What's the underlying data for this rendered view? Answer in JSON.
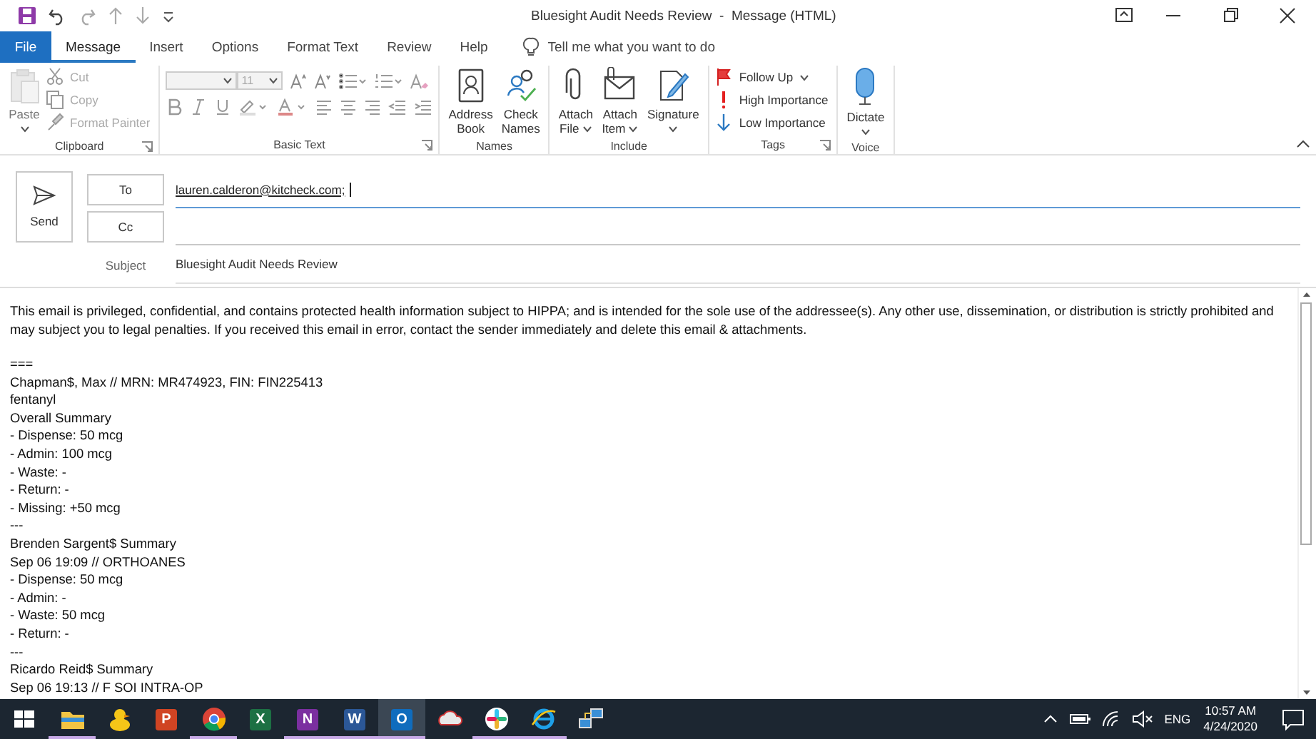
{
  "window": {
    "title": "Bluesight Audit Needs Review  -  Message (HTML)"
  },
  "tabs": [
    {
      "label": "File",
      "kind": "file",
      "selected": false
    },
    {
      "label": "Message",
      "kind": "tab",
      "selected": true
    },
    {
      "label": "Insert",
      "kind": "tab",
      "selected": false
    },
    {
      "label": "Options",
      "kind": "tab",
      "selected": false
    },
    {
      "label": "Format Text",
      "kind": "tab",
      "selected": false
    },
    {
      "label": "Review",
      "kind": "tab",
      "selected": false
    },
    {
      "label": "Help",
      "kind": "tab",
      "selected": false
    }
  ],
  "tell_me": {
    "placeholder": "Tell me what you want to do"
  },
  "ribbon": {
    "groups": [
      {
        "label": "Clipboard",
        "launcher": true,
        "large": [
          {
            "lines": [
              "Paste"
            ],
            "caret": true,
            "disabled": true
          }
        ],
        "small": [
          {
            "label": "Cut",
            "disabled": true
          },
          {
            "label": "Copy",
            "disabled": true
          },
          {
            "label": "Format Painter",
            "disabled": true
          }
        ]
      },
      {
        "label": "Basic Text",
        "launcher": true,
        "kind": "font",
        "font_size": "11",
        "disabled": true
      },
      {
        "label": "Names",
        "large": [
          {
            "lines": [
              "Address",
              "Book"
            ],
            "caret": false,
            "disabled": false
          },
          {
            "lines": [
              "Check",
              "Names"
            ],
            "caret": false,
            "disabled": false
          }
        ]
      },
      {
        "label": "Include",
        "large": [
          {
            "lines": [
              "Attach",
              "File"
            ],
            "caret": true,
            "disabled": false
          },
          {
            "lines": [
              "Attach",
              "Item"
            ],
            "caret": true,
            "disabled": false
          },
          {
            "lines": [
              "Signature"
            ],
            "caret": true,
            "disabled": false
          }
        ]
      },
      {
        "label": "Tags",
        "launcher": true,
        "small": [
          {
            "label": "Follow Up",
            "caret": true,
            "disabled": false
          },
          {
            "label": "High Importance",
            "disabled": false
          },
          {
            "label": "Low Importance",
            "disabled": false
          }
        ]
      },
      {
        "label": "Voice",
        "large": [
          {
            "lines": [
              "Dictate"
            ],
            "caret": true,
            "disabled": false
          }
        ]
      }
    ]
  },
  "compose": {
    "send": "Send",
    "to_button": "To",
    "to_value": "lauren.calderon@kitcheck.com;",
    "cc_button": "Cc",
    "subject_label": "Subject",
    "subject_value": "Bluesight Audit Needs Review"
  },
  "body": {
    "disclaimer": "This email is privileged, confidential, and contains protected health information subject to HIPPA; and is intended for the sole use of the addressee(s). Any other use, dissemination, or distribution is strictly prohibited and may subject you to legal penalties. If you received this email in error, contact the sender immediately and delete this email & attachments.",
    "lines": [
      "===",
      "Chapman$, Max // MRN: MR474923, FIN: FIN225413",
      "fentanyl",
      "Overall Summary",
      "- Dispense: 50 mcg",
      "- Admin: 100 mcg",
      "- Waste: -",
      "- Return: -",
      "- Missing: +50 mcg",
      "---",
      "Brenden Sargent$ Summary",
      "Sep 06 19:09 // ORTHOANES",
      "- Dispense: 50 mcg",
      "- Admin: -",
      "- Waste: 50 mcg",
      "- Return: -",
      "---",
      "Ricardo Reid$ Summary",
      "Sep 06 19:13 // F SOI INTRA-OP"
    ]
  },
  "taskbar": {
    "apps": [
      {
        "kind": "folder",
        "running": true,
        "active": false
      },
      {
        "kind": "duck",
        "running": false,
        "active": false
      },
      {
        "kind": "letter",
        "glyph": "P",
        "color": "#d04423",
        "running": false,
        "active": false
      },
      {
        "kind": "chrome",
        "running": true,
        "active": false
      },
      {
        "kind": "letter",
        "glyph": "X",
        "color": "#1d7044",
        "running": false,
        "active": false
      },
      {
        "kind": "letter",
        "glyph": "N",
        "color": "#7b2fa0",
        "running": true,
        "active": false
      },
      {
        "kind": "letter",
        "glyph": "W",
        "color": "#2b5797",
        "running": true,
        "active": false
      },
      {
        "kind": "letter",
        "glyph": "O",
        "color": "#0f6cbd",
        "running": true,
        "active": true
      },
      {
        "kind": "cloud",
        "running": false,
        "active": false
      },
      {
        "kind": "pinwheel",
        "running": true,
        "active": false
      },
      {
        "kind": "globe",
        "running": true,
        "active": false
      },
      {
        "kind": "network",
        "running": false,
        "active": false
      }
    ],
    "language": "ENG",
    "time": "10:57 AM",
    "date": "4/24/2020"
  }
}
